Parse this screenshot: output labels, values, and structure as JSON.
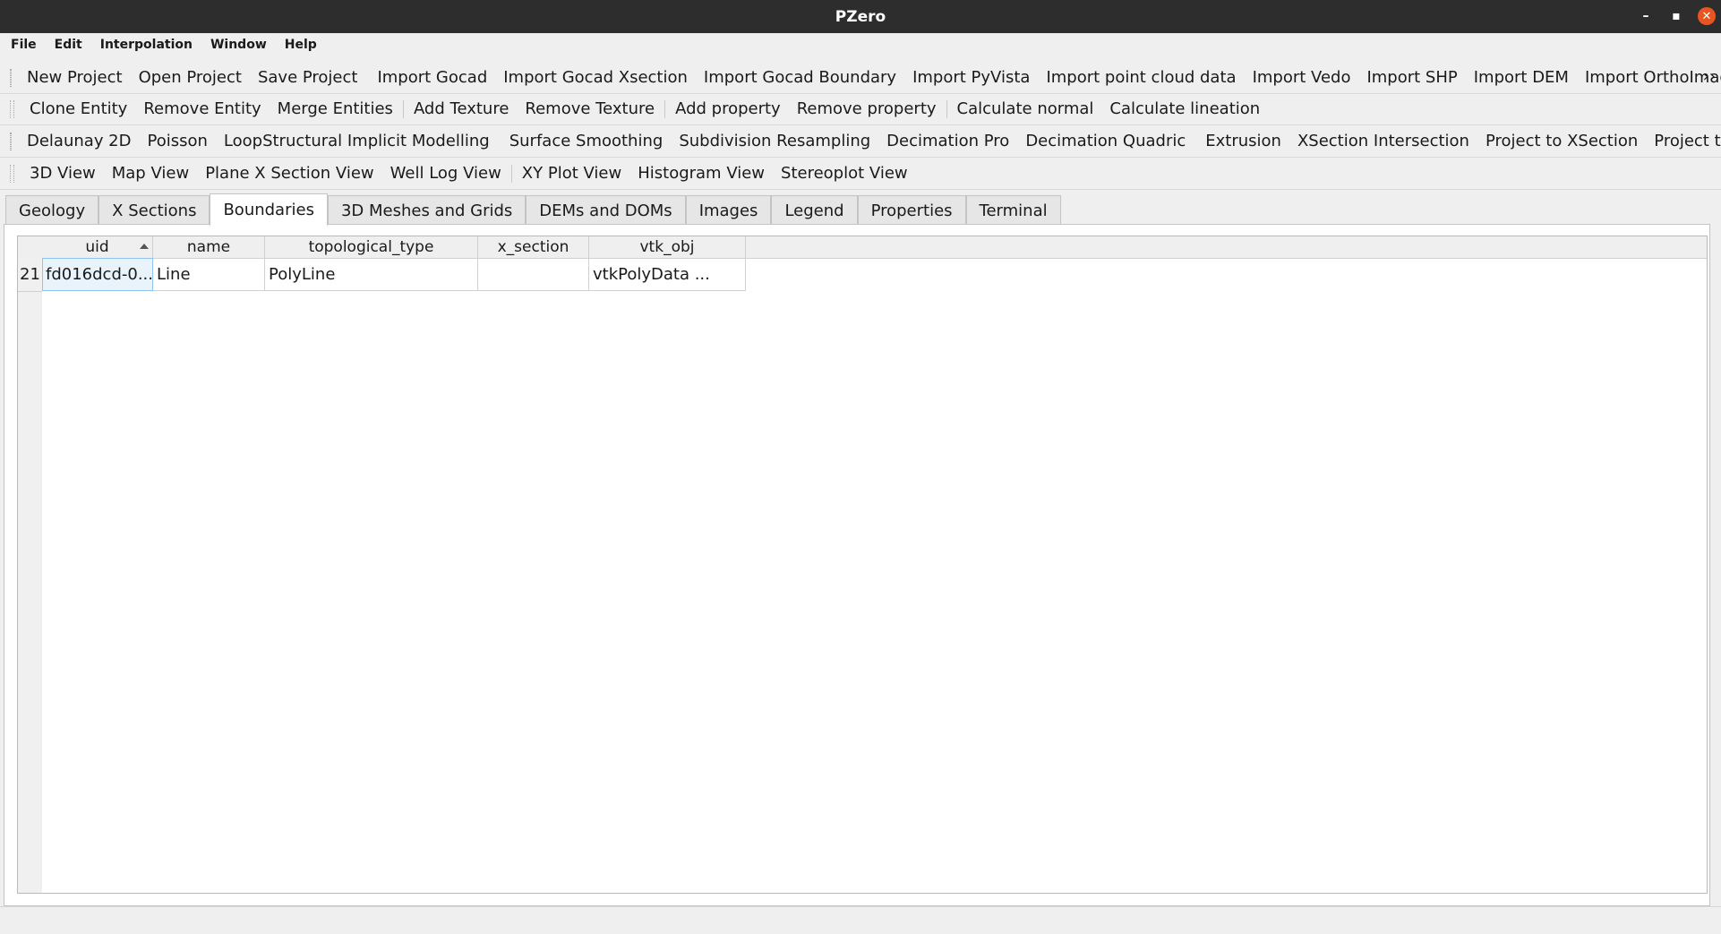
{
  "window": {
    "title": "PZero"
  },
  "menu": [
    "File",
    "Edit",
    "Interpolation",
    "Window",
    "Help"
  ],
  "toolbars": [
    {
      "groups": [
        [
          "New Project",
          "Open Project",
          "Save Project"
        ],
        [
          "Import Gocad",
          "Import Gocad Xsection",
          "Import Gocad Boundary",
          "Import PyVista",
          "Import point cloud data",
          "Import Vedo",
          "Import SHP",
          "Import DEM",
          "Import OrthoImage"
        ]
      ]
    },
    {
      "groups": [
        [
          "Clone Entity",
          "Remove Entity",
          "Merge Entities"
        ],
        [
          "Add Texture",
          "Remove Texture"
        ],
        [
          "Add property",
          "Remove property"
        ],
        [
          "Calculate normal",
          "Calculate lineation"
        ]
      ]
    },
    {
      "groups": [
        [
          "Delaunay 2D",
          "Poisson",
          "LoopStructural Implicit Modelling"
        ],
        [
          "Surface Smoothing",
          "Subdivision Resampling",
          "Decimation Pro",
          "Decimation Quadric"
        ],
        [
          "Extrusion",
          "XSection Intersection",
          "Project to XSection",
          "Project to DEM"
        ]
      ]
    },
    {
      "groups": [
        [
          "3D View",
          "Map View",
          "Plane X Section View",
          "Well Log View"
        ],
        [
          "XY Plot View",
          "Histogram View",
          "Stereoplot View"
        ]
      ]
    }
  ],
  "toolbar_overflow": "››",
  "tabs": [
    "Geology",
    "X Sections",
    "Boundaries",
    "3D Meshes and Grids",
    "DEMs and DOMs",
    "Images",
    "Legend",
    "Properties",
    "Terminal"
  ],
  "active_tab": "Boundaries",
  "table": {
    "columns": [
      "uid",
      "name",
      "topological_type",
      "x_section",
      "vtk_obj"
    ],
    "sorted_column": "uid",
    "rows": [
      {
        "num": "21",
        "cells": [
          "fd016dcd-0...",
          "Line",
          "PolyLine",
          "",
          "vtkPolyData ..."
        ]
      }
    ]
  },
  "colors": {
    "titlebar": "#2d2d2d",
    "close_button": "#e95420",
    "selection": "#e8f3fc"
  }
}
